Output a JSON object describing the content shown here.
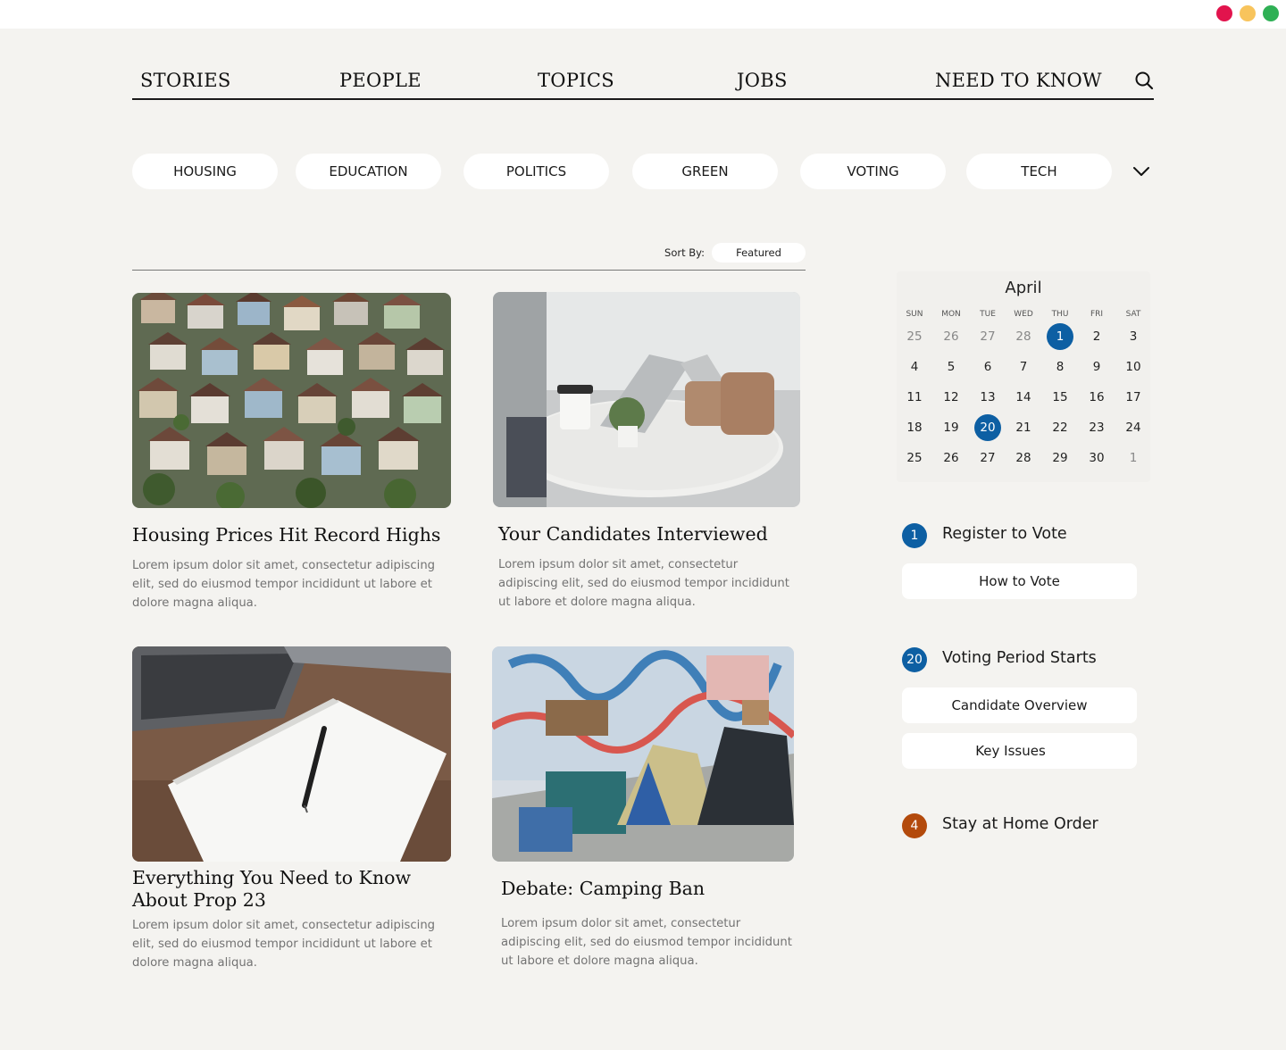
{
  "nav": {
    "items": [
      "STORIES",
      "PEOPLE",
      "TOPICS",
      "JOBS",
      "NEED TO KNOW"
    ],
    "search_icon": "search-icon"
  },
  "chips": {
    "items": [
      "HOUSING",
      "EDUCATION",
      "POLITICS",
      "GREEN",
      "VOTING",
      "TECH"
    ],
    "more_icon": "chevron-down-icon"
  },
  "sort": {
    "label": "Sort By:",
    "value": "Featured"
  },
  "articles": [
    {
      "title": "Housing Prices Hit Record Highs",
      "body": "Lorem ipsum dolor sit amet, consectetur adipiscing elit, sed do eiusmod tempor incididunt ut labore et dolore magna aliqua.",
      "image": "aerial-houses-photo"
    },
    {
      "title": "Your Candidates Interviewed",
      "body": "Lorem ipsum dolor sit amet, consectetur adipiscing elit, sed do eiusmod tempor incididunt ut labore et dolore magna aliqua.",
      "image": "laptops-coffee-table-photo"
    },
    {
      "title": "Everything You Need to Know About Prop 23",
      "body": "Lorem ipsum dolor sit amet, consectetur adipiscing elit, sed do eiusmod tempor incididunt ut labore et dolore magna aliqua.",
      "image": "notebook-pen-laptop-photo"
    },
    {
      "title": "Debate: Camping Ban",
      "body": "Lorem ipsum dolor sit amet, consectetur adipiscing elit, sed do eiusmod tempor incididunt ut labore et dolore magna aliqua.",
      "image": "tents-mural-street-photo"
    }
  ],
  "calendar": {
    "month": "April",
    "weekdays": [
      "SUN",
      "MON",
      "TUE",
      "WED",
      "THU",
      "FRI",
      "SAT"
    ],
    "weeks": [
      [
        "25",
        "26",
        "27",
        "28",
        "1",
        "2",
        "3"
      ],
      [
        "4",
        "5",
        "6",
        "7",
        "8",
        "9",
        "10"
      ],
      [
        "11",
        "12",
        "13",
        "14",
        "15",
        "16",
        "17"
      ],
      [
        "18",
        "19",
        "20",
        "21",
        "22",
        "23",
        "24"
      ],
      [
        "25",
        "26",
        "27",
        "28",
        "29",
        "30",
        "1"
      ]
    ],
    "muted_cells": [
      "0-0",
      "0-1",
      "0-2",
      "0-3",
      "4-6"
    ],
    "highlighted_cells": [
      "0-4",
      "3-2"
    ],
    "highlight_color": "#0d5fa3"
  },
  "events": [
    {
      "badge": "1",
      "title": "Register to Vote",
      "badge_color": "#0d5fa3",
      "buttons": [
        "How to Vote"
      ]
    },
    {
      "badge": "20",
      "title": "Voting Period Starts",
      "badge_color": "#0d5fa3",
      "buttons": [
        "Candidate Overview",
        "Key Issues"
      ]
    },
    {
      "badge": "4",
      "title": "Stay at Home Order",
      "badge_color": "#b34a0c",
      "buttons": []
    }
  ],
  "window_controls": {
    "colors": [
      "#e2144d",
      "#f8c45c",
      "#2fb055"
    ]
  }
}
